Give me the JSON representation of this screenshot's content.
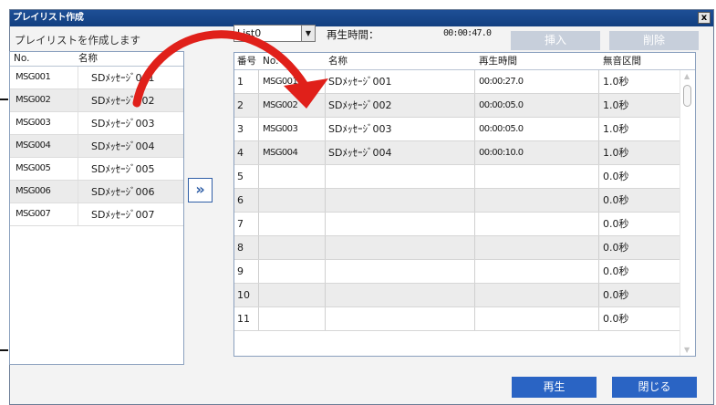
{
  "window": {
    "title": "プレイリスト作成",
    "close_label": "x"
  },
  "instruction": "プレイリストを作成します",
  "left_list": {
    "headers": {
      "no": "No.",
      "name": "名称"
    },
    "rows": [
      {
        "no": "MSG001",
        "name": "SDﾒｯｾｰｼﾞ001"
      },
      {
        "no": "MSG002",
        "name": "SDﾒｯｾｰｼﾞ002"
      },
      {
        "no": "MSG003",
        "name": "SDﾒｯｾｰｼﾞ003"
      },
      {
        "no": "MSG004",
        "name": "SDﾒｯｾｰｼﾞ004"
      },
      {
        "no": "MSG005",
        "name": "SDﾒｯｾｰｼﾞ005"
      },
      {
        "no": "MSG006",
        "name": "SDﾒｯｾｰｼﾞ006"
      },
      {
        "no": "MSG007",
        "name": "SDﾒｯｾｰｼﾞ007"
      }
    ]
  },
  "move_button": "»",
  "list_select": {
    "value": "List0"
  },
  "playtime": {
    "label": "再生時間：",
    "value": "00:00:47.0"
  },
  "buttons": {
    "insert": "挿入",
    "delete": "削除",
    "play": "再生",
    "close": "閉じる"
  },
  "playlist_grid": {
    "headers": {
      "index": "番号",
      "no": "No.",
      "name": "名称",
      "time": "再生時間",
      "silence": "無音区間"
    },
    "rows": [
      {
        "index": "1",
        "no": "MSG001",
        "name": "SDﾒｯｾｰｼﾞ001",
        "time": "00:00:27.0",
        "silence": "1.0秒"
      },
      {
        "index": "2",
        "no": "MSG002",
        "name": "SDﾒｯｾｰｼﾞ002",
        "time": "00:00:05.0",
        "silence": "1.0秒"
      },
      {
        "index": "3",
        "no": "MSG003",
        "name": "SDﾒｯｾｰｼﾞ003",
        "time": "00:00:05.0",
        "silence": "1.0秒"
      },
      {
        "index": "4",
        "no": "MSG004",
        "name": "SDﾒｯｾｰｼﾞ004",
        "time": "00:00:10.0",
        "silence": "1.0秒"
      },
      {
        "index": "5",
        "no": "",
        "name": "",
        "time": "",
        "silence": "0.0秒"
      },
      {
        "index": "6",
        "no": "",
        "name": "",
        "time": "",
        "silence": "0.0秒"
      },
      {
        "index": "7",
        "no": "",
        "name": "",
        "time": "",
        "silence": "0.0秒"
      },
      {
        "index": "8",
        "no": "",
        "name": "",
        "time": "",
        "silence": "0.0秒"
      },
      {
        "index": "9",
        "no": "",
        "name": "",
        "time": "",
        "silence": "0.0秒"
      },
      {
        "index": "10",
        "no": "",
        "name": "",
        "time": "",
        "silence": "0.0秒"
      },
      {
        "index": "11",
        "no": "",
        "name": "",
        "time": "",
        "silence": "0.0秒"
      }
    ]
  },
  "colors": {
    "accent": "#2a64c4",
    "titlebar": "#1e4f96",
    "disabled_button": "#c7cfdb",
    "annotation_arrow": "#e0201a"
  }
}
